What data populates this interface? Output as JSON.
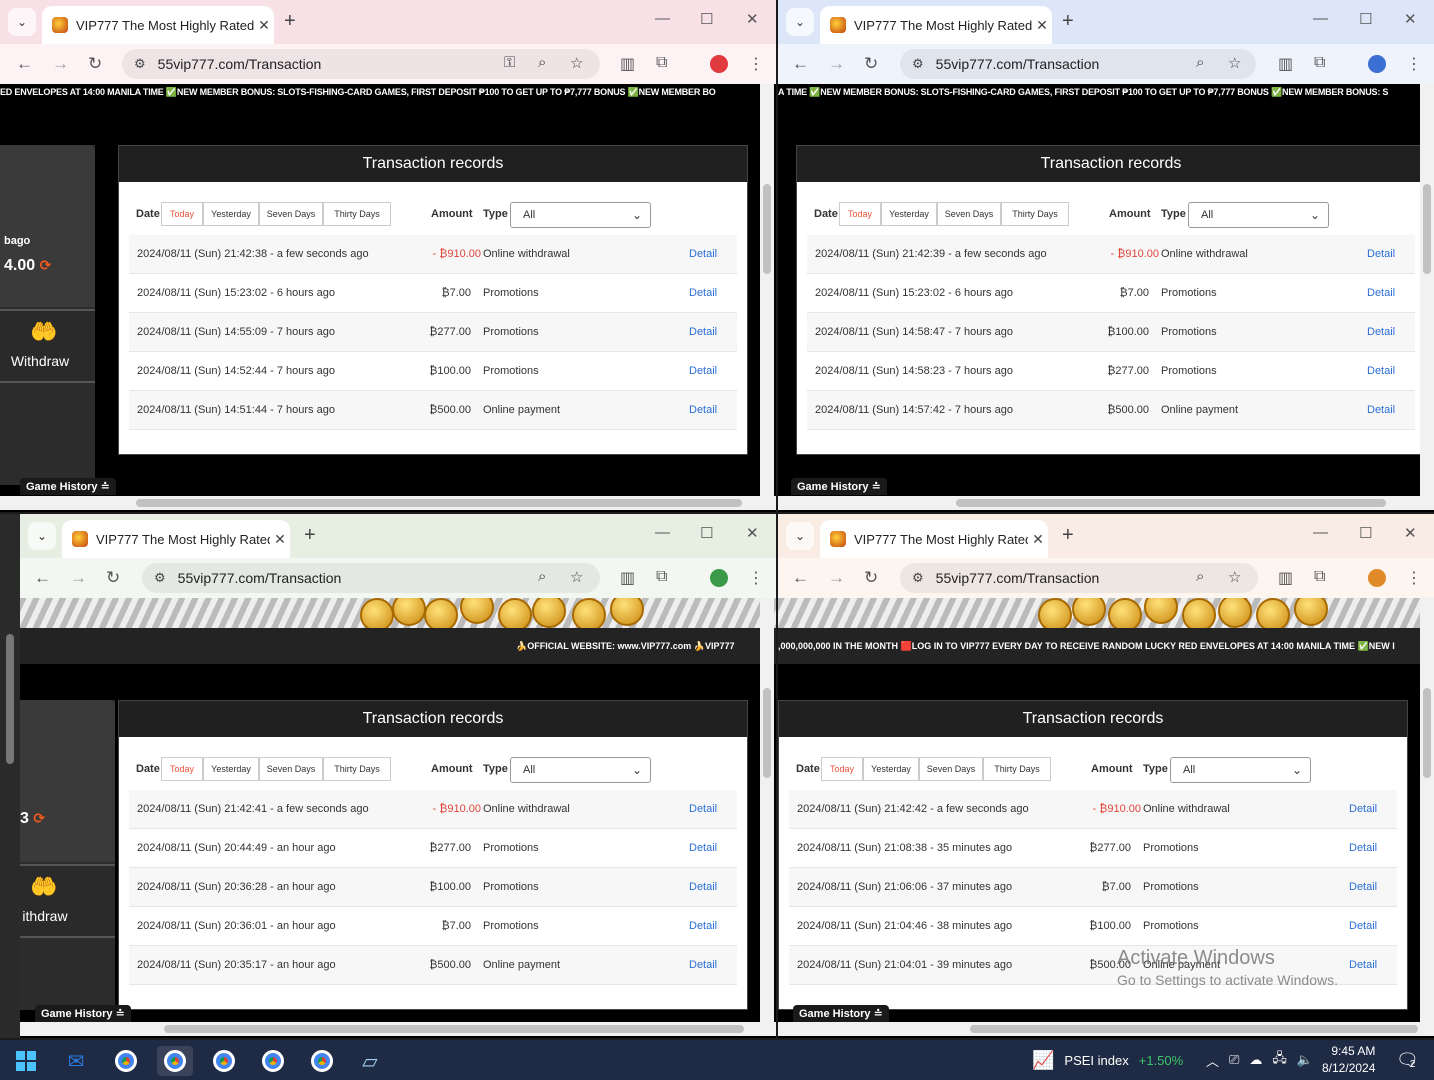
{
  "browser": {
    "tab_title": "VIP777 The Most Highly Rated",
    "tab_close": "✕",
    "new_tab": "+",
    "url": "55vip777.com/Transaction"
  },
  "page": {
    "title": "Transaction records",
    "filters": {
      "date_label": "Date",
      "buttons": [
        "Today",
        "Yesterday",
        "Seven Days",
        "Thirty Days"
      ],
      "amount_label": "Amount",
      "type_label": "Type",
      "type_selected": "All"
    },
    "detail_label": "Detail",
    "game_history": "Game History ≐",
    "sidebar": {
      "username": "bago",
      "balance": "4.00",
      "withdraw": "Withdraw",
      "withdraw_cut": "ithdraw",
      "balance_cut": "3"
    }
  },
  "windows": [
    {
      "ticker": "ED ENVELOPES AT 14:00 MANILA TIME  ✅NEW MEMBER BONUS: SLOTS-FISHING-CARD GAMES, FIRST DEPOSIT ₱100 TO GET UP TO ₱7,777 BONUS  ✅NEW MEMBER BO",
      "rows": [
        {
          "date": "2024/08/11 (Sun) 21:42:38 - a few seconds ago",
          "amount": "- ₿910.00",
          "type": "Online withdrawal"
        },
        {
          "date": "2024/08/11 (Sun) 15:23:02 - 6 hours ago",
          "amount": "₿7.00",
          "type": "Promotions"
        },
        {
          "date": "2024/08/11 (Sun) 14:55:09 - 7 hours ago",
          "amount": "₿277.00",
          "type": "Promotions"
        },
        {
          "date": "2024/08/11 (Sun) 14:52:44 - 7 hours ago",
          "amount": "₿100.00",
          "type": "Promotions"
        },
        {
          "date": "2024/08/11 (Sun) 14:51:44 - 7 hours ago",
          "amount": "₿500.00",
          "type": "Online payment"
        }
      ]
    },
    {
      "ticker": "A TIME  ✅NEW MEMBER BONUS: SLOTS-FISHING-CARD GAMES, FIRST DEPOSIT ₱100 TO GET UP TO ₱7,777 BONUS  ✅NEW MEMBER BONUS: S",
      "rows": [
        {
          "date": "2024/08/11 (Sun) 21:42:39 - a few seconds ago",
          "amount": "- ₿910.00",
          "type": "Online withdrawal"
        },
        {
          "date": "2024/08/11 (Sun) 15:23:02 - 6 hours ago",
          "amount": "₿7.00",
          "type": "Promotions"
        },
        {
          "date": "2024/08/11 (Sun) 14:58:47 - 7 hours ago",
          "amount": "₿100.00",
          "type": "Promotions"
        },
        {
          "date": "2024/08/11 (Sun) 14:58:23 - 7 hours ago",
          "amount": "₿277.00",
          "type": "Promotions"
        },
        {
          "date": "2024/08/11 (Sun) 14:57:42 - 7 hours ago",
          "amount": "₿500.00",
          "type": "Online payment"
        }
      ]
    },
    {
      "ticker": "🍌OFFICIAL WEBSITE:  www.VIP777.com   🍌VIP777",
      "rows": [
        {
          "date": "2024/08/11 (Sun) 21:42:41 - a few seconds ago",
          "amount": "- ₿910.00",
          "type": "Online withdrawal"
        },
        {
          "date": "2024/08/11 (Sun) 20:44:49 - an hour ago",
          "amount": "₿277.00",
          "type": "Promotions"
        },
        {
          "date": "2024/08/11 (Sun) 20:36:28 - an hour ago",
          "amount": "₿100.00",
          "type": "Promotions"
        },
        {
          "date": "2024/08/11 (Sun) 20:36:01 - an hour ago",
          "amount": "₿7.00",
          "type": "Promotions"
        },
        {
          "date": "2024/08/11 (Sun) 20:35:17 - an hour ago",
          "amount": "₿500.00",
          "type": "Online payment"
        }
      ]
    },
    {
      "ticker": ",000,000,000 IN THE MONTH  🟥LOG IN TO VIP777 EVERY DAY TO RECEIVE RANDOM LUCKY RED ENVELOPES AT 14:00 MANILA TIME  ✅NEW I",
      "rows": [
        {
          "date": "2024/08/11 (Sun) 21:42:42 - a few seconds ago",
          "amount": "- ₿910.00",
          "type": "Online withdrawal"
        },
        {
          "date": "2024/08/11 (Sun) 21:08:38 - 35 minutes ago",
          "amount": "₿277.00",
          "type": "Promotions"
        },
        {
          "date": "2024/08/11 (Sun) 21:06:06 - 37 minutes ago",
          "amount": "₿7.00",
          "type": "Promotions"
        },
        {
          "date": "2024/08/11 (Sun) 21:04:46 - 38 minutes ago",
          "amount": "₿100.00",
          "type": "Promotions"
        },
        {
          "date": "2024/08/11 (Sun) 21:04:01 - 39 minutes ago",
          "amount": "₿500.00",
          "type": "Online payment"
        }
      ]
    }
  ],
  "watermark": {
    "line1": "Activate Windows",
    "line2": "Go to Settings to activate Windows."
  },
  "taskbar": {
    "stock_name": "PSEI index",
    "stock_change": "+1.50%",
    "time": "9:45 AM",
    "date": "8/12/2024",
    "notifications": "2"
  },
  "colors": {
    "accent_red": "#e0453a",
    "link_blue": "#2b6fd6",
    "stock_green": "#3cc46a"
  }
}
